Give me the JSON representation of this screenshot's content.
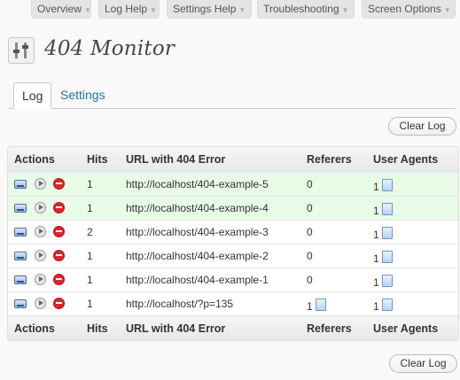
{
  "help_tabs": [
    {
      "label": "Overview"
    },
    {
      "label": "Log Help"
    },
    {
      "label": "Settings Help"
    },
    {
      "label": "Troubleshooting"
    },
    {
      "label": "Screen Options"
    }
  ],
  "page": {
    "title": "404 Monitor"
  },
  "tabs": [
    {
      "label": "Log"
    },
    {
      "label": "Settings"
    }
  ],
  "clear_log_label": "Clear Log",
  "table": {
    "columns": [
      "Actions",
      "Hits",
      "URL with 404 Error",
      "Referers",
      "User Agents"
    ],
    "rows": [
      {
        "hits": "1",
        "url": "http://localhost/404-example-5",
        "referers": "0",
        "user_agents": "1",
        "highlight": true
      },
      {
        "hits": "1",
        "url": "http://localhost/404-example-4",
        "referers": "0",
        "user_agents": "1",
        "highlight": true
      },
      {
        "hits": "2",
        "url": "http://localhost/404-example-3",
        "referers": "0",
        "user_agents": "1",
        "highlight": false
      },
      {
        "hits": "1",
        "url": "http://localhost/404-example-2",
        "referers": "0",
        "user_agents": "1",
        "highlight": false
      },
      {
        "hits": "1",
        "url": "http://localhost/404-example-1",
        "referers": "0",
        "user_agents": "1",
        "highlight": false
      },
      {
        "hits": "1",
        "url": "http://localhost/?p=135",
        "referers": "1",
        "user_agents": "1",
        "highlight": false
      }
    ]
  },
  "colors": {
    "highlight_row": "#e8fbe6",
    "link": "#21759b",
    "delete": "#d8272d"
  }
}
